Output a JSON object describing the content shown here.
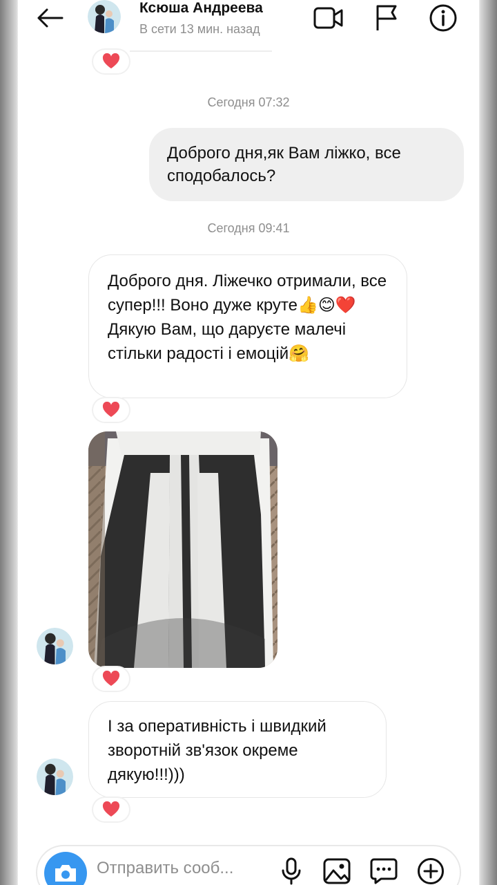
{
  "header": {
    "name": "Ксюша Андреева",
    "status": "В сети 13 мин. назад"
  },
  "messages": [
    {
      "type": "timestamp",
      "text": "Сегодня 07:32"
    },
    {
      "type": "outgoing",
      "text": "Доброго дня,як Вам ліжко, все сподобалось?"
    },
    {
      "type": "timestamp",
      "text": "Сегодня 09:41"
    },
    {
      "type": "incoming",
      "text": "Доброго дня. Ліжечко отримали, все супер!!! Воно дуже круте👍😊❤️ Дякую Вам, що даруєте малечі стільки радості і емоцій🤗",
      "reaction": "heart"
    },
    {
      "type": "incoming-photo",
      "reaction": "heart"
    },
    {
      "type": "incoming",
      "text": "І за оперативність і швидкий зворотній зв'язок окреме дякую!!!)))",
      "reaction": "heart"
    }
  ],
  "composer": {
    "placeholder": "Отправить сооб..."
  },
  "colors": {
    "accent": "#3797f0",
    "reaction_heart": "#ed4956",
    "outgoing_bubble": "#efefef"
  },
  "icons": [
    "back-arrow-icon",
    "video-call-icon",
    "flag-icon",
    "info-icon",
    "heart-icon",
    "camera-icon",
    "microphone-icon",
    "gallery-icon",
    "sticker-icon",
    "plus-icon"
  ]
}
